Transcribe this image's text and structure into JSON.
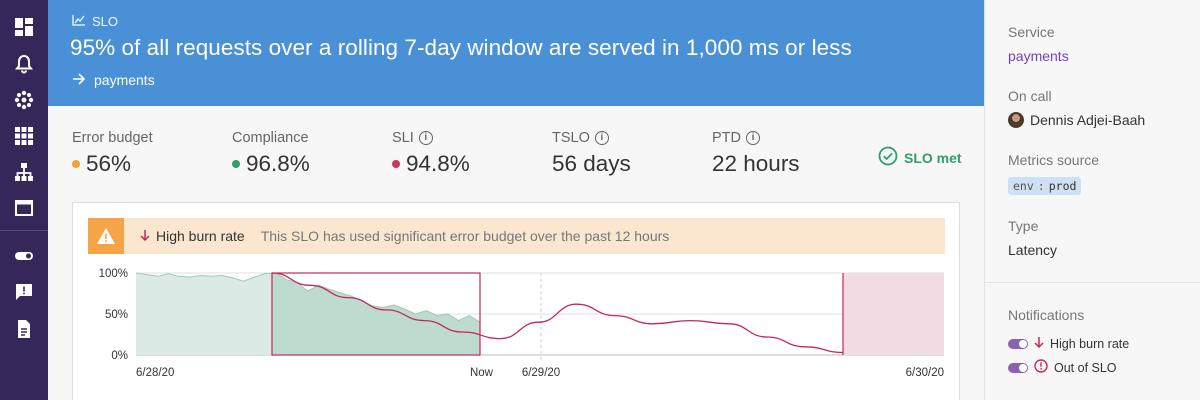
{
  "nav": {
    "items": [
      {
        "icon": "dashboard-icon"
      },
      {
        "icon": "bell-icon"
      },
      {
        "icon": "apps-circle-icon"
      },
      {
        "icon": "grid-icon"
      },
      {
        "icon": "sitemap-icon"
      },
      {
        "icon": "window-icon"
      },
      {
        "icon": "toggle-icon"
      },
      {
        "icon": "feedback-icon"
      },
      {
        "icon": "document-icon"
      }
    ]
  },
  "header": {
    "kicker": "SLO",
    "title": "95% of all requests over a rolling 7-day window are served in 1,000 ms or less",
    "service_link": "payments"
  },
  "stats": [
    {
      "label": "Error budget",
      "value": "56%",
      "dot_color": "#f5a030",
      "info": false
    },
    {
      "label": "Compliance",
      "value": "96.8%",
      "dot_color": "#2f9e6e",
      "info": false
    },
    {
      "label": "SLI",
      "value": "94.8%",
      "dot_color": "#d0345e",
      "info": true
    },
    {
      "label": "TSLO",
      "value": "56 days",
      "dot_color": null,
      "info": true
    },
    {
      "label": "PTD",
      "value": "22 hours",
      "dot_color": null,
      "info": true
    }
  ],
  "status": "SLO met",
  "alert": {
    "title": "High burn rate",
    "message": "This SLO has used significant error budget over the past 12 hours"
  },
  "chart_data": {
    "type": "area",
    "y_ticks": [
      "100%",
      "50%",
      "0%"
    ],
    "x_labels": [
      "6/28/20",
      "Now",
      "6/29/20",
      "6/30/20"
    ],
    "ylim": [
      0,
      100
    ],
    "series": [
      {
        "color": "#3a9a78",
        "values": [
          100,
          98,
          96,
          99,
          96,
          95,
          97,
          96,
          97,
          94,
          90,
          95,
          99,
          100,
          92,
          88,
          78,
          85,
          80,
          76,
          72,
          66,
          60,
          58,
          61,
          56,
          50,
          54,
          48,
          50,
          42,
          48,
          40
        ]
      }
    ],
    "projection": {
      "color": "#c3285a",
      "values": [
        100,
        85,
        70,
        55,
        42,
        28,
        20,
        40,
        62,
        48,
        38,
        42,
        38,
        22,
        10,
        3
      ]
    }
  },
  "sidebar": {
    "service_label": "Service",
    "service_value": "payments",
    "oncall_label": "On call",
    "oncall_value": "Dennis Adjei-Baah",
    "metrics_label": "Metrics source",
    "tag_key": "env",
    "tag_sep": ":",
    "tag_value": "prod",
    "type_label": "Type",
    "type_value": "Latency",
    "notifications_label": "Notifications",
    "notifications": [
      {
        "label": "High burn rate",
        "icon": "arrow-down-icon",
        "enabled": true
      },
      {
        "label": "Out of SLO",
        "icon": "alert-circle-icon",
        "enabled": true
      }
    ]
  },
  "colors": {
    "nav_bg": "#36275a",
    "header_bg": "#4a90d6",
    "alert_bg": "#fbe7cf",
    "alert_icon_bg": "#f5a548",
    "accent": "#7b3fb4"
  }
}
